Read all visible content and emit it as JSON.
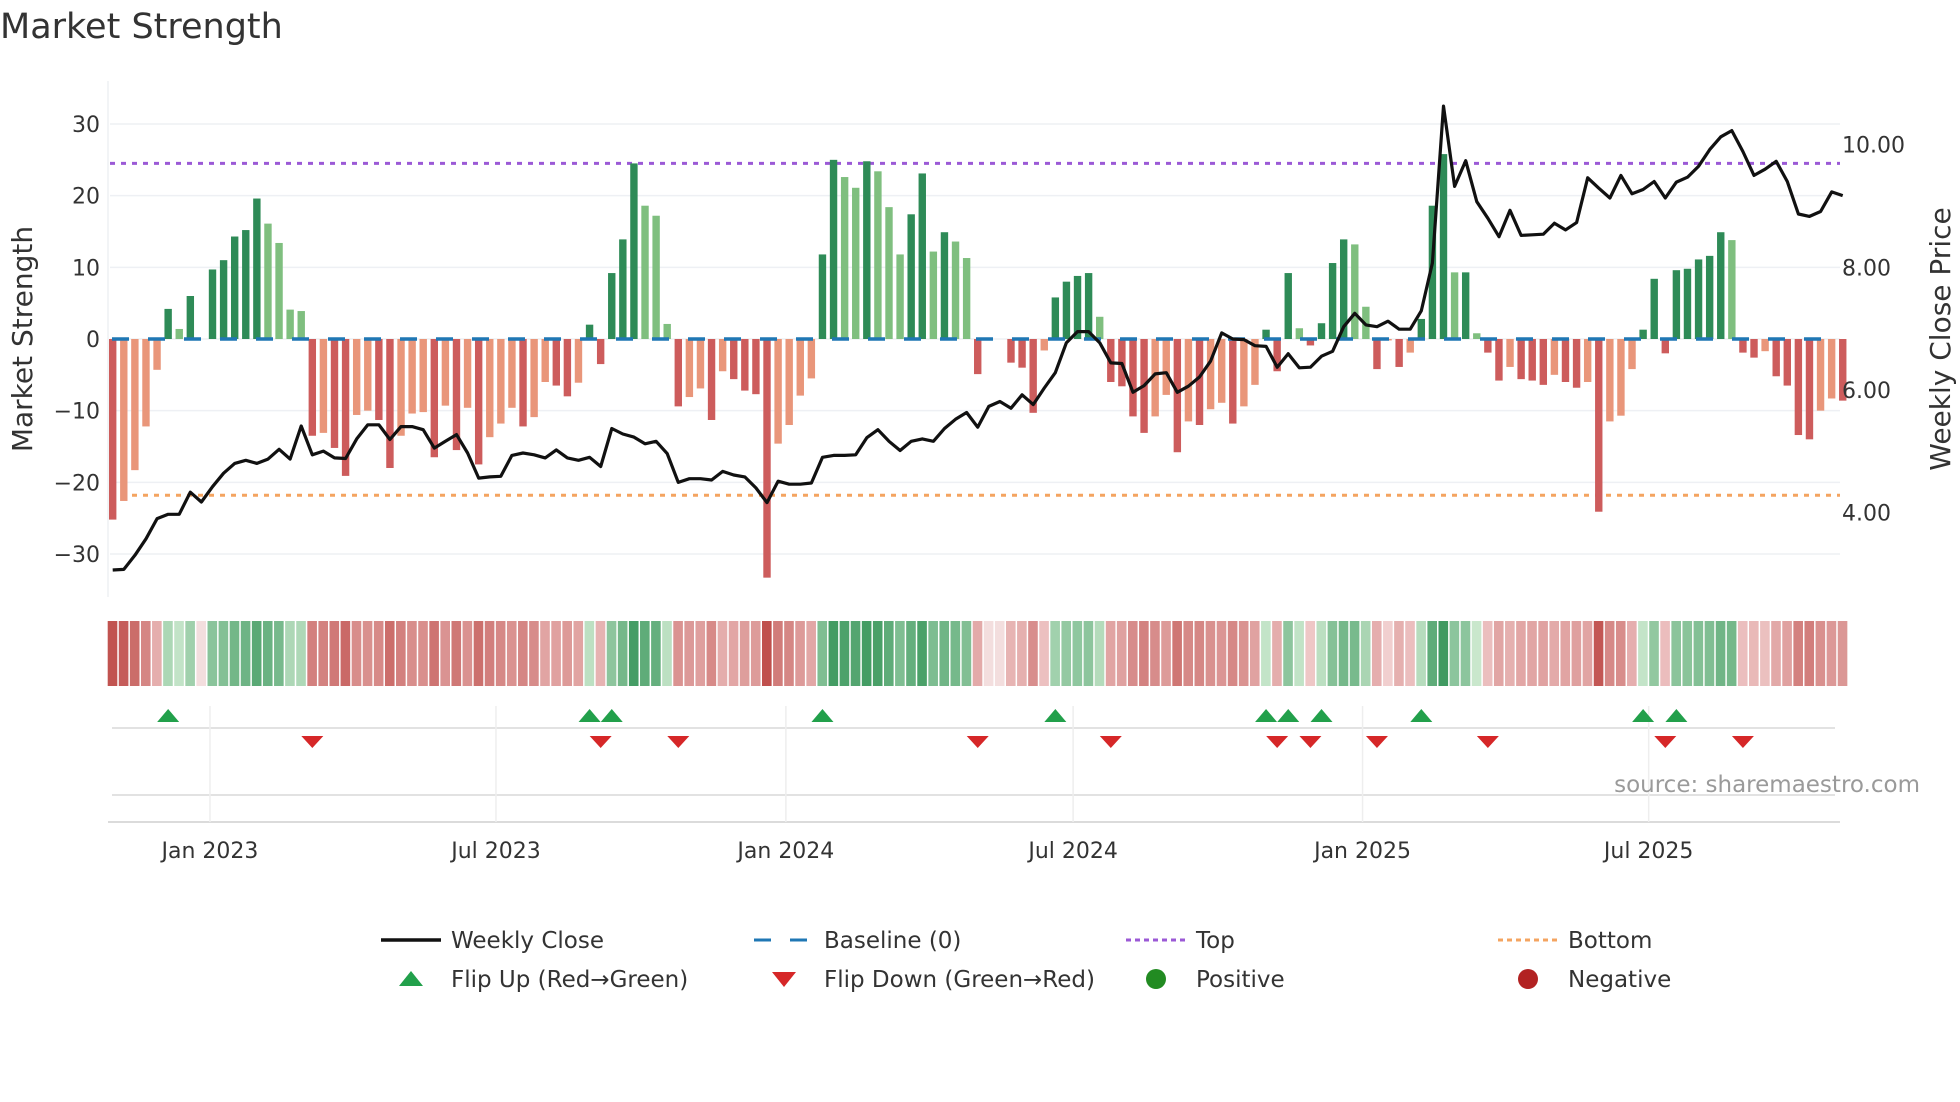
{
  "title": "Market Strength",
  "source": "source: sharemaestro.com",
  "colors": {
    "pos_dark": "#2e8b57",
    "pos_light": "#7fbf7f",
    "neg_dark": "#cd5c5c",
    "neg_light": "#e9967a",
    "line": "#111111",
    "baseline": "#1f77b4",
    "top": "#9b59d6",
    "bottom": "#f4a460",
    "flip_up": "#22a04b",
    "flip_down": "#d62728",
    "positive": "#228b22",
    "negative": "#b22222",
    "grid": "#eef0f4"
  },
  "chart_data": {
    "type": "bar+line",
    "title": "Market Strength",
    "ylabel_left": "Market Strength",
    "ylabel_right": "Weekly Close Price",
    "ylim_left": [
      -36,
      36
    ],
    "ylim_right": [
      2.62,
      11.04
    ],
    "yticks_left": [
      {
        "v": 30,
        "label": "30"
      },
      {
        "v": 20,
        "label": "20"
      },
      {
        "v": 10,
        "label": "10"
      },
      {
        "v": 0,
        "label": "0"
      },
      {
        "v": -10,
        "label": "−10"
      },
      {
        "v": -20,
        "label": "−20"
      },
      {
        "v": -30,
        "label": "−30"
      }
    ],
    "yticks_right": [
      {
        "v": 10,
        "label": "10.00"
      },
      {
        "v": 8,
        "label": "8.00"
      },
      {
        "v": 6,
        "label": "6.00"
      },
      {
        "v": 4,
        "label": "4.00"
      }
    ],
    "xticks": [
      {
        "week": 8.77,
        "label": "Jan 2023"
      },
      {
        "week": 34.56,
        "label": "Jul 2023"
      },
      {
        "week": 60.7,
        "label": "Jan 2024"
      },
      {
        "week": 86.6,
        "label": "Jul 2024"
      },
      {
        "week": 112.7,
        "label": "Jan 2025"
      },
      {
        "week": 138.5,
        "label": "Jul 2025"
      }
    ],
    "top": 24.5,
    "bottom": -21.8,
    "baseline": 0,
    "strength": [
      -25.2,
      -22.6,
      -18.3,
      -12.2,
      -4.3,
      4.2,
      1.4,
      6.0,
      0,
      9.7,
      11.0,
      14.3,
      15.2,
      19.6,
      16.1,
      13.4,
      4.1,
      3.9,
      -13.5,
      -13.1,
      -15.2,
      -19.1,
      -10.6,
      -10.0,
      -11.3,
      -18.0,
      -13.5,
      -10.4,
      -10.2,
      -16.5,
      -9.3,
      -15.5,
      -9.6,
      -17.5,
      -13.7,
      -11.8,
      -9.6,
      -12.2,
      -10.9,
      -6.0,
      -6.5,
      -8.0,
      -6.1,
      2.0,
      -3.5,
      9.2,
      13.9,
      24.5,
      18.6,
      17.2,
      2.1,
      -9.4,
      -8.1,
      -6.9,
      -11.3,
      -4.5,
      -5.6,
      -7.2,
      -7.7,
      -33.3,
      -14.6,
      -12.0,
      -7.9,
      -5.5,
      11.8,
      25.0,
      22.6,
      21.1,
      24.8,
      23.4,
      18.4,
      11.8,
      17.4,
      23.1,
      12.2,
      14.9,
      13.6,
      11.3,
      -4.9,
      0,
      0,
      -3.3,
      -4.0,
      -10.3,
      -1.6,
      5.8,
      8.0,
      8.8,
      9.2,
      3.1,
      -6.0,
      -6.6,
      -10.8,
      -13.1,
      -10.8,
      -7.8,
      -15.8,
      -11.5,
      -12.0,
      -9.8,
      -8.9,
      -11.8,
      -9.4,
      -6.4,
      1.3,
      -4.5,
      9.2,
      1.5,
      -0.9,
      2.2,
      10.6,
      13.9,
      13.2,
      4.5,
      -4.2,
      -0.2,
      -3.9,
      -1.9,
      2.8,
      18.6,
      25.8,
      9.3,
      9.3,
      0.8,
      -1.9,
      -5.8,
      -3.9,
      -5.6,
      -5.8,
      -6.4,
      -5.0,
      -6.0,
      -6.8,
      -6.0,
      -24.1,
      -11.5,
      -10.7,
      -4.2,
      1.3,
      8.4,
      -2.0,
      9.6,
      9.8,
      11.1,
      11.6,
      14.9,
      13.8,
      -1.9,
      -2.6,
      -1.7,
      -5.2,
      -6.5,
      -13.4,
      -14.0,
      -10.0,
      -8.3,
      -8.6
    ],
    "weekly_close": [
      3.06,
      3.07,
      3.3,
      3.57,
      3.9,
      3.97,
      3.97,
      4.33,
      4.17,
      4.42,
      4.64,
      4.8,
      4.85,
      4.8,
      4.87,
      5.03,
      4.87,
      5.41,
      4.94,
      5.0,
      4.89,
      4.88,
      5.2,
      5.43,
      5.43,
      5.19,
      5.4,
      5.4,
      5.35,
      5.05,
      5.16,
      5.27,
      4.97,
      4.56,
      4.58,
      4.59,
      4.93,
      4.97,
      4.94,
      4.89,
      5.02,
      4.89,
      4.85,
      4.9,
      4.75,
      5.37,
      5.28,
      5.23,
      5.12,
      5.16,
      4.96,
      4.49,
      4.55,
      4.55,
      4.53,
      4.67,
      4.61,
      4.58,
      4.4,
      4.16,
      4.51,
      4.46,
      4.46,
      4.48,
      4.9,
      4.93,
      4.93,
      4.94,
      5.22,
      5.35,
      5.16,
      5.01,
      5.16,
      5.2,
      5.16,
      5.37,
      5.52,
      5.63,
      5.39,
      5.73,
      5.81,
      5.7,
      5.92,
      5.76,
      6.03,
      6.28,
      6.77,
      6.95,
      6.95,
      6.77,
      6.44,
      6.43,
      5.96,
      6.07,
      6.26,
      6.28,
      5.96,
      6.06,
      6.21,
      6.47,
      6.93,
      6.83,
      6.82,
      6.72,
      6.71,
      6.37,
      6.59,
      6.36,
      6.37,
      6.55,
      6.63,
      7.03,
      7.25,
      7.06,
      7.03,
      7.12,
      6.99,
      6.99,
      7.29,
      8.07,
      10.63,
      9.32,
      9.74,
      9.07,
      8.8,
      8.5,
      8.93,
      8.52,
      8.53,
      8.54,
      8.72,
      8.61,
      8.73,
      9.46,
      9.29,
      9.13,
      9.5,
      9.2,
      9.27,
      9.4,
      9.13,
      9.39,
      9.47,
      9.65,
      9.92,
      10.13,
      10.23,
      9.89,
      9.5,
      9.6,
      9.73,
      9.4,
      8.87,
      8.83,
      8.91,
      9.23,
      9.17
    ],
    "legend": [
      {
        "label": "Weekly Close",
        "kind": "line"
      },
      {
        "label": "Baseline (0)",
        "kind": "dash"
      },
      {
        "label": "Top",
        "kind": "dot-top"
      },
      {
        "label": "Bottom",
        "kind": "dot-bottom"
      },
      {
        "label": "Flip Up (Red→Green)",
        "kind": "tri-up"
      },
      {
        "label": "Flip Down (Green→Red)",
        "kind": "tri-down"
      },
      {
        "label": "Positive",
        "kind": "circle-pos"
      },
      {
        "label": "Negative",
        "kind": "circle-neg"
      }
    ],
    "legend_placement": "bottom"
  }
}
